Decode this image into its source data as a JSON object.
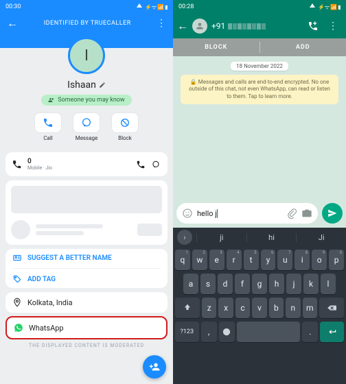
{
  "left": {
    "status_time": "00:30",
    "status_icons": "⎋ ⌔ ⌬ Vo 4G ▲▯",
    "header_sub": "IDENTIFIED BY TRUECALLER",
    "avatar_letter": "I",
    "name": "Ishaan",
    "chip": "Someone you may know",
    "actions": {
      "call": "Call",
      "message": "Message",
      "block": "Block"
    },
    "sim": {
      "number": "0",
      "carrier": "Mobile · Jio"
    },
    "suggest_name": "SUGGEST A BETTER NAME",
    "add_tag": "ADD TAG",
    "location": "Kolkata, India",
    "whatsapp": "WhatsApp",
    "moderated": "THE DISPLAYED CONTENT IS MODERATED"
  },
  "right": {
    "status_time": "00:28",
    "status_icons": "⎋ ⌔ ⌬ Vo 4G ▲▯",
    "phone_prefix": "+91",
    "block": "BLOCK",
    "add": "ADD",
    "date": "18 November 2022",
    "encryption": "Messages and calls are end-to-end encrypted. No one outside of this chat, not even WhatsApp, can read or listen to them. Tap to learn more.",
    "input_text": "hello j",
    "suggestions": [
      "ji",
      "hi",
      "Ji"
    ],
    "sym_key": "?123",
    "rows": {
      "r1": [
        "q",
        "w",
        "e",
        "r",
        "t",
        "y",
        "u",
        "i",
        "o",
        "p"
      ],
      "r1s": [
        "1",
        "2",
        "3",
        "4",
        "5",
        "6",
        "7",
        "8",
        "9",
        "0"
      ],
      "r2": [
        "a",
        "s",
        "d",
        "f",
        "g",
        "h",
        "j",
        "k",
        "l"
      ],
      "r3": [
        "z",
        "x",
        "c",
        "v",
        "b",
        "n",
        "m"
      ]
    }
  }
}
